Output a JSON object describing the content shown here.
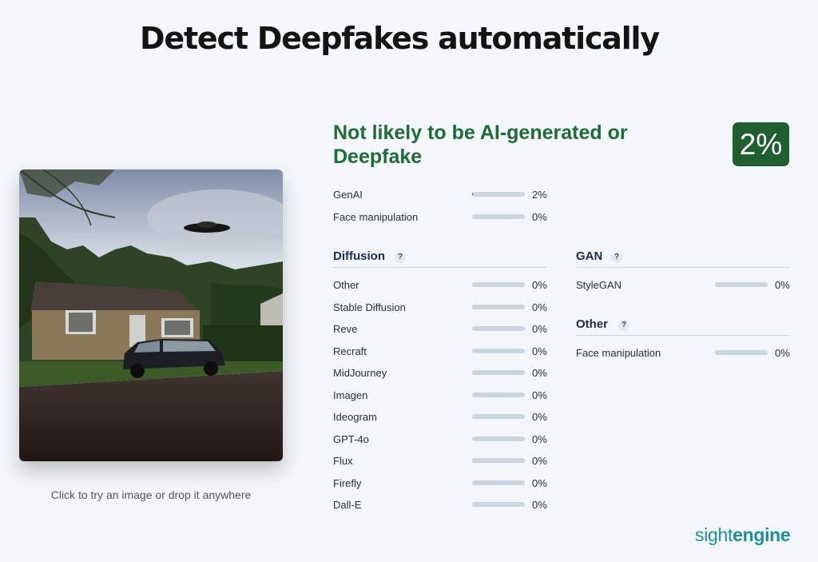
{
  "header": {
    "title": "Detect Deepfakes automatically"
  },
  "upload": {
    "hint": "Click to try an image or drop it anywhere"
  },
  "result": {
    "verdict": "Not likely to be AI-generated or Deepfake",
    "score": "2%",
    "verdict_color": "#1e6b35",
    "badge_color": "#1e5e2f",
    "bar_fill_color": "#d43a3a"
  },
  "summary": [
    {
      "label": "GenAI",
      "value": "2%",
      "fraction": 0.02
    },
    {
      "label": "Face manipulation",
      "value": "0%",
      "fraction": 0
    }
  ],
  "diffusion": {
    "title": "Diffusion",
    "help": "?",
    "items": [
      {
        "label": "Other",
        "value": "0%",
        "fraction": 0
      },
      {
        "label": "Stable Diffusion",
        "value": "0%",
        "fraction": 0
      },
      {
        "label": "Reve",
        "value": "0%",
        "fraction": 0
      },
      {
        "label": "Recraft",
        "value": "0%",
        "fraction": 0
      },
      {
        "label": "MidJourney",
        "value": "0%",
        "fraction": 0
      },
      {
        "label": "Imagen",
        "value": "0%",
        "fraction": 0
      },
      {
        "label": "Ideogram",
        "value": "0%",
        "fraction": 0
      },
      {
        "label": "GPT-4o",
        "value": "0%",
        "fraction": 0
      },
      {
        "label": "Flux",
        "value": "0%",
        "fraction": 0
      },
      {
        "label": "Firefly",
        "value": "0%",
        "fraction": 0
      },
      {
        "label": "Dall-E",
        "value": "0%",
        "fraction": 0
      }
    ]
  },
  "gan": {
    "title": "GAN",
    "help": "?",
    "items": [
      {
        "label": "StyleGAN",
        "value": "0%",
        "fraction": 0
      }
    ]
  },
  "other": {
    "title": "Other",
    "help": "?",
    "items": [
      {
        "label": "Face manipulation",
        "value": "0%",
        "fraction": 0
      }
    ]
  },
  "brand": {
    "part1": "sight",
    "part2": "engine",
    "color": "#1f8ea0"
  }
}
